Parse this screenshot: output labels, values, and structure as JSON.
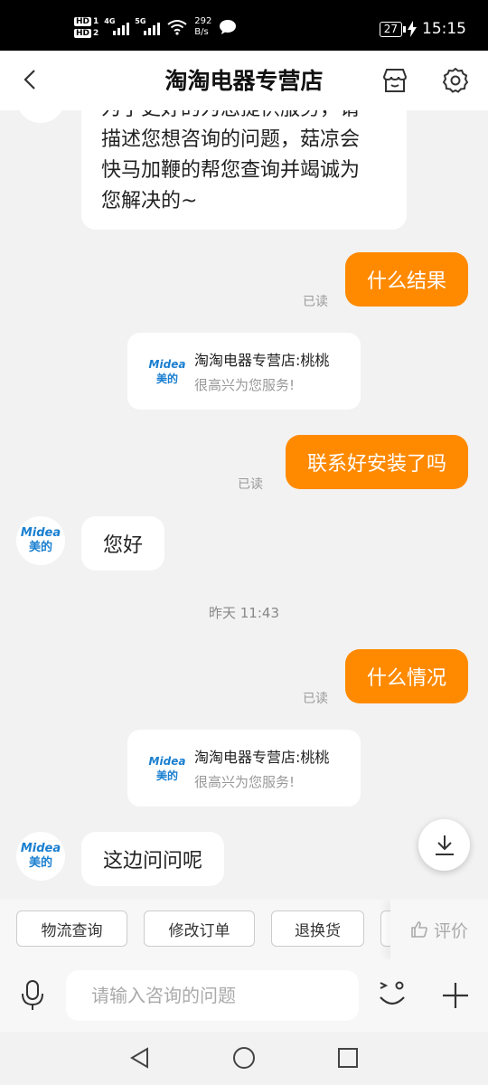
{
  "status_bar": {
    "hd1": "HD",
    "hd1_num": "1",
    "hd2": "HD",
    "hd2_num": "2",
    "net1": "4G",
    "net2": "5G",
    "speed_value": "292",
    "speed_unit": "B/s",
    "battery": "27",
    "time": "15:15"
  },
  "header": {
    "title": "淘淘电器专营店",
    "icons": [
      "back-icon",
      "store-icon",
      "settings-icon"
    ]
  },
  "messages": {
    "first_bubble_lines": [
      "为了更好的为您提供服务，请",
      "描述您想咨询的问题，菇凉会",
      "快马加鞭的帮您查询并竭诚为",
      "您解决的~"
    ],
    "msg1": {
      "text": "什么结果",
      "read": "已读"
    },
    "card1": {
      "title": "淘淘电器专营店:桃桃",
      "sub": "很高兴为您服务!"
    },
    "msg2": {
      "text": "联系好安装了吗",
      "read": "已读"
    },
    "msg3": {
      "text": "您好"
    },
    "timestamp": "昨天 11:43",
    "msg4": {
      "text": "什么情况",
      "read": "已读"
    },
    "card2": {
      "title": "淘淘电器专营店:桃桃",
      "sub": "很高兴为您服务!"
    },
    "msg5": {
      "text": "这边问问呢"
    }
  },
  "avatar": {
    "en": "Midea",
    "cn": "美的"
  },
  "quick_actions": [
    "物流查询",
    "修改订单",
    "退换货"
  ],
  "rate_label": "评价",
  "input": {
    "placeholder": "请输入咨询的问题"
  },
  "colors": {
    "accent": "#ff8a00",
    "brand_blue": "#1a7fd0"
  }
}
